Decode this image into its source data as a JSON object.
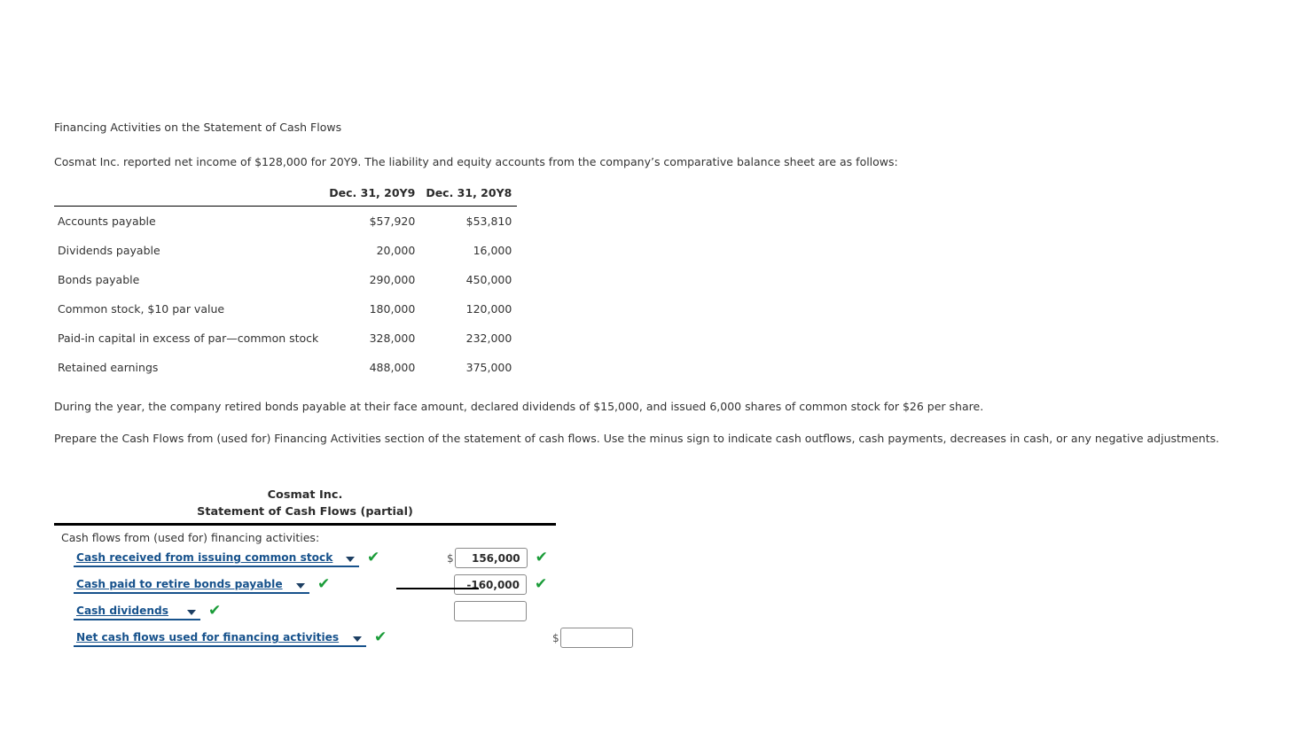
{
  "exercise": {
    "title": "Financing Activities on the Statement of Cash Flows",
    "intro": "Cosmat Inc. reported net income of $128,000 for 20Y9. The liability and equity accounts from the company’s comparative balance sheet are as follows:",
    "note": "During the year, the company retired bonds payable at their face amount, declared dividends of $15,000, and issued 6,000 shares of common stock for $26 per share.",
    "instruction": "Prepare the Cash Flows from (used for) Financing Activities section of the statement of cash flows. Use the minus sign to indicate cash outflows, cash payments, decreases in cash, or any negative adjustments."
  },
  "balance_table": {
    "headers": [
      "",
      "Dec. 31, 20Y9",
      "Dec. 31, 20Y8"
    ],
    "rows": [
      {
        "label": "Accounts payable",
        "y9": "$57,920",
        "y8": "$53,810"
      },
      {
        "label": "Dividends payable",
        "y9": "20,000",
        "y8": "16,000"
      },
      {
        "label": "Bonds payable",
        "y9": "290,000",
        "y8": "450,000"
      },
      {
        "label": "Common stock, $10 par value",
        "y9": "180,000",
        "y8": "120,000"
      },
      {
        "label": "Paid-in capital in excess of par—common stock",
        "y9": "328,000",
        "y8": "232,000"
      },
      {
        "label": "Retained earnings",
        "y9": "488,000",
        "y8": "375,000"
      }
    ]
  },
  "statement": {
    "company": "Cosmat Inc.",
    "title": "Statement of Cash Flows (partial)",
    "section_label": "Cash flows from (used for) financing activities:",
    "dollar_symbol": "$",
    "check_glyph": "✔",
    "accent_color": "#17528c",
    "check_color": "#1a9c38",
    "options": [
      "Cash received from issuing common stock",
      "Cash paid to retire bonds payable",
      "Cash dividends",
      "Net cash flows used for financing activities"
    ],
    "rows": [
      {
        "selected": "Cash received from issuing common stock",
        "select_width": 322,
        "select_checked": true,
        "amount": "156,000",
        "amount_placeholder": "",
        "show_dollar": true,
        "amount_checked": true
      },
      {
        "selected": "Cash paid to retire bonds payable",
        "select_width": 266,
        "select_checked": true,
        "amount": "-160,000",
        "amount_placeholder": "",
        "show_dollar": false,
        "amount_checked": true
      },
      {
        "selected": "Cash dividends",
        "select_width": 143,
        "select_checked": true,
        "amount": "",
        "amount_placeholder": "",
        "show_dollar": false,
        "amount_checked": false
      },
      {
        "selected": "Net cash flows used for financing activities",
        "select_width": 330,
        "select_checked": true,
        "amount": "",
        "amount_placeholder": "",
        "show_dollar": true,
        "amount_checked": false
      }
    ]
  }
}
